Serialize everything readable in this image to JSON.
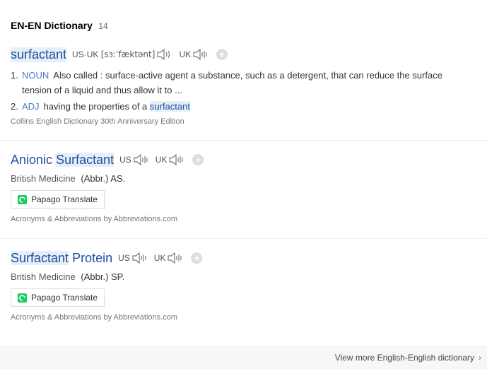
{
  "header": {
    "title": "EN-EN Dictionary",
    "count": "14"
  },
  "entry1": {
    "word": "surfactant",
    "phonetic_label": "US·UK",
    "phonetic_ipa": "[sɜːˈfæktənt]",
    "uk_label": "UK",
    "definitions": [
      {
        "num": "1.",
        "pos": "NOUN",
        "text": "Also called : surface-active agent a substance, such as a detergent, that can reduce the surface tension of a liquid and thus allow it to ..."
      },
      {
        "num": "2.",
        "pos": "ADJ",
        "text": "having the properties of a",
        "highlight": "surfactant"
      }
    ],
    "source": "Collins English Dictionary 30th Anniversary Edition"
  },
  "entry2": {
    "word_a": "Anionic",
    "word_b": "Surfactant",
    "us_label": "US",
    "uk_label": "UK",
    "category": "British Medicine",
    "abbr": "(Abbr.) AS.",
    "translate_label": "Papago Translate",
    "source": "Acronyms & Abbreviations by Abbreviations.com"
  },
  "entry3": {
    "word_a": "Surfactant",
    "word_b": "Protein",
    "us_label": "US",
    "uk_label": "UK",
    "category": "British Medicine",
    "abbr": "(Abbr.) SP.",
    "translate_label": "Papago Translate",
    "source": "Acronyms & Abbreviations by Abbreviations.com"
  },
  "footer": {
    "more_label": "View more English-English dictionary",
    "chevron": "›"
  },
  "colors": {
    "link": "#1f4fa3",
    "pos": "#4a7cc0",
    "highlight_bg": "#e6eef8",
    "papago_green": "#19ce60"
  }
}
